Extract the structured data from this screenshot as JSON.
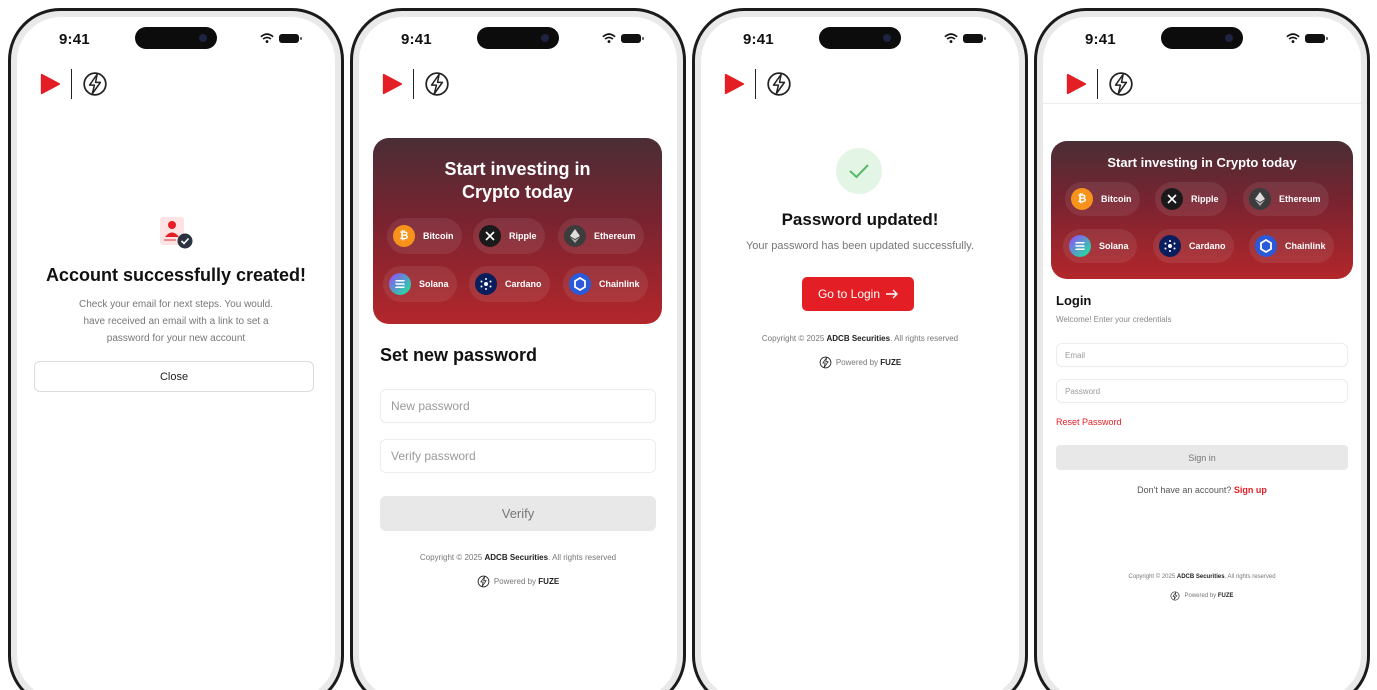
{
  "status": {
    "time": "9:41"
  },
  "icons": {
    "brand_play": "play-triangle-logo",
    "brand_bolt": "lightning-circle-logo",
    "check": "check-icon",
    "arrow": "arrow-right-icon",
    "account": "user-check-icon"
  },
  "colors": {
    "brand_red": "#e31e24",
    "card_top": "#4a2e35",
    "card_bottom": "#b3272b",
    "success_bg": "#e3f5e5",
    "success_check": "#57b86b"
  },
  "screen1": {
    "title": "Account successfully created!",
    "message_lines": [
      "Check your email for next steps. You would.",
      "have received an email with a link to set a",
      "password for your new account"
    ],
    "close_label": "Close"
  },
  "screen2": {
    "card_title_lines": [
      "Start investing in",
      "Crypto today"
    ],
    "coins": [
      "Bitcoin",
      "Ripple",
      "Ethereum",
      "Solana",
      "Cardano",
      "Chainlink"
    ],
    "heading": "Set new password",
    "new_password_placeholder": "New password",
    "verify_password_placeholder": "Verify password",
    "verify_label": "Verify",
    "copyright_prefix": "Copyright © 2025 ",
    "copyright_brand": "ADCB Securities",
    "copyright_suffix": ". All rights reserved",
    "powered_prefix": "Powered by ",
    "powered_brand": "FUZE"
  },
  "screen3": {
    "title": "Password updated!",
    "message": "Your password has been updated successfully.",
    "button_label": "Go to Login",
    "copyright_prefix": "Copyright © 2025 ",
    "copyright_brand": "ADCB Securities",
    "copyright_suffix": ". All rights reserved",
    "powered_prefix": "Powered by ",
    "powered_brand": "FUZE"
  },
  "screen4": {
    "card_title": "Start investing in Crypto today",
    "coins": [
      "Bitcoin",
      "Ripple",
      "Ethereum",
      "Solana",
      "Cardano",
      "Chainlink"
    ],
    "login_title": "Login",
    "login_subtitle": "Welcome! Enter your credentials",
    "email_placeholder": "Email",
    "password_placeholder": "Password",
    "reset_label": "Reset Password",
    "signin_label": "Sign in",
    "signup_prompt": "Don't have an account? ",
    "signup_link": "Sign up",
    "copyright_prefix": "Copyright © 2025 ",
    "copyright_brand": "ADCB Securities",
    "copyright_suffix": ". All rights reserved",
    "powered_prefix": "Powered by ",
    "powered_brand": "FUZE"
  }
}
